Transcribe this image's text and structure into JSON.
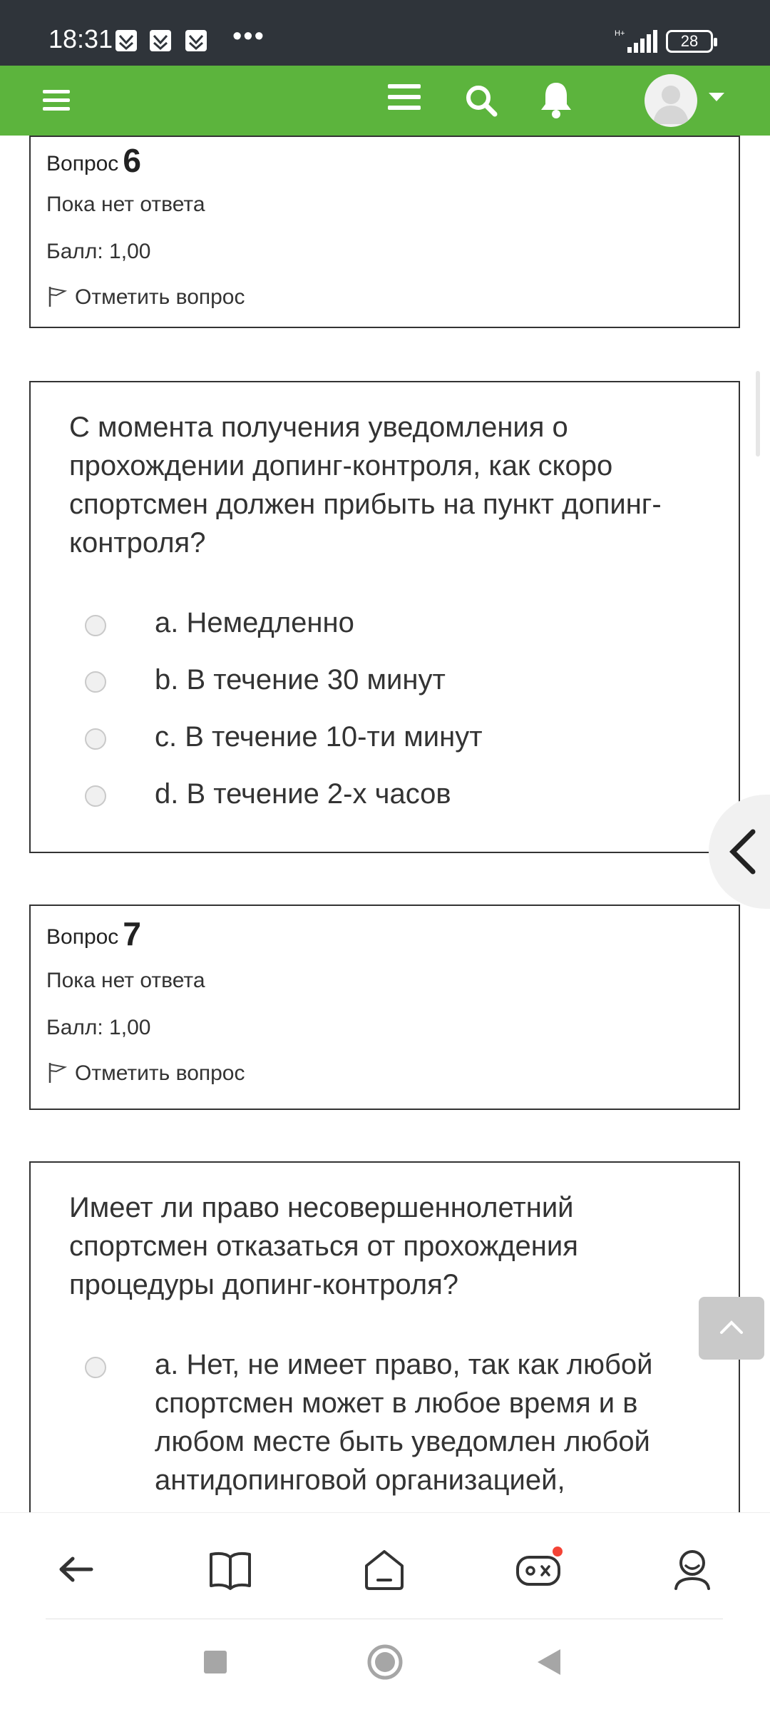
{
  "status_bar": {
    "time": "18:31",
    "more": "•••",
    "network": "H+",
    "battery": "28"
  },
  "header": {
    "menu_icon": "hamburger-icon",
    "nav_icon": "hamburger-icon",
    "search_icon": "search-icon",
    "notifications_icon": "bell-icon",
    "avatar_icon": "user-avatar-icon",
    "accent_color": "#5cb43d"
  },
  "question6_info": {
    "label": "Вопрос",
    "number": "6",
    "status": "Пока нет ответа",
    "score": "Балл: 1,00",
    "flag_label": "Отметить вопрос"
  },
  "question6": {
    "text": "С момента получения уведомления о прохождении допинг-контроля, как скоро спортсмен должен прибыть на пункт допинг-контроля?",
    "options": [
      "a. Немедленно",
      "b. В течение 30 минут",
      "c. В течение 10-ти минут",
      "d. В течение 2-х часов"
    ]
  },
  "question7_info": {
    "label": "Вопрос",
    "number": "7",
    "status": "Пока нет ответа",
    "score": "Балл: 1,00",
    "flag_label": "Отметить вопрос"
  },
  "question7": {
    "text": "Имеет ли право несовершеннолетний спортсмен отказаться от прохождения процедуры допинг-контроля?",
    "options": [
      "a. Нет, не имеет право, так как любой спортсмен может в любое время и в любом месте быть уведомлен любой антидопинговой организацией,"
    ]
  },
  "bottom_nav": {
    "back_icon": "back-arrow-icon",
    "book_icon": "book-icon",
    "home_icon": "home-icon",
    "games_icon": "gamepad-icon",
    "profile_icon": "profile-icon"
  }
}
